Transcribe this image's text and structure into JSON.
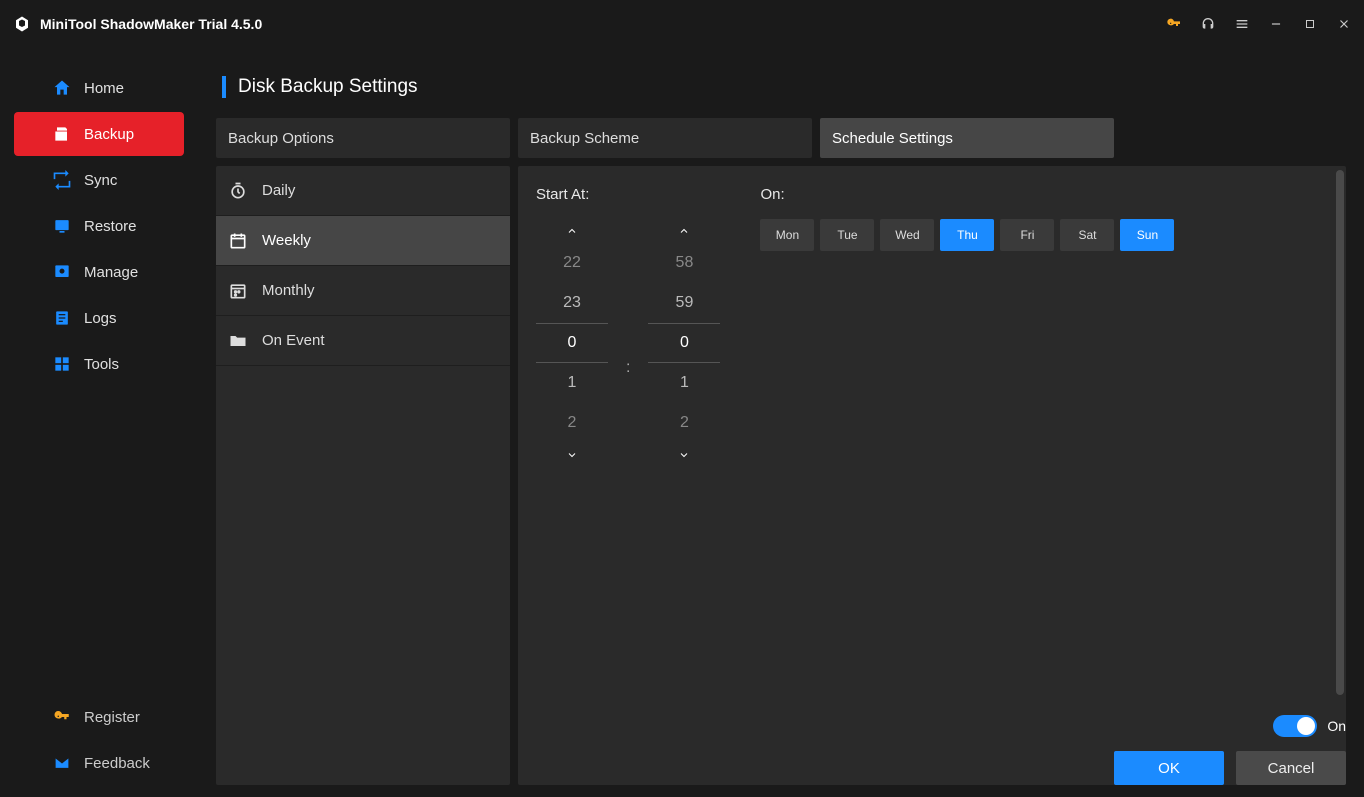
{
  "app": {
    "title": "MiniTool ShadowMaker Trial 4.5.0"
  },
  "sidebar": {
    "items": [
      {
        "label": "Home"
      },
      {
        "label": "Backup"
      },
      {
        "label": "Sync"
      },
      {
        "label": "Restore"
      },
      {
        "label": "Manage"
      },
      {
        "label": "Logs"
      },
      {
        "label": "Tools"
      }
    ],
    "bottom": [
      {
        "label": "Register"
      },
      {
        "label": "Feedback"
      }
    ]
  },
  "page": {
    "title": "Disk Backup Settings"
  },
  "tabs": [
    {
      "label": "Backup Options"
    },
    {
      "label": "Backup Scheme"
    },
    {
      "label": "Schedule Settings"
    }
  ],
  "frequency": [
    {
      "label": "Daily"
    },
    {
      "label": "Weekly"
    },
    {
      "label": "Monthly"
    },
    {
      "label": "On Event"
    }
  ],
  "schedule": {
    "start_label": "Start At:",
    "on_label": "On:",
    "hour": {
      "m2": "22",
      "m1": "23",
      "sel": "0",
      "p1": "1",
      "p2": "2"
    },
    "minute": {
      "m2": "58",
      "m1": "59",
      "sel": "0",
      "p1": "1",
      "p2": "2"
    },
    "colon": ":",
    "days": [
      {
        "label": "Mon",
        "active": false
      },
      {
        "label": "Tue",
        "active": false
      },
      {
        "label": "Wed",
        "active": false
      },
      {
        "label": "Thu",
        "active": true
      },
      {
        "label": "Fri",
        "active": false
      },
      {
        "label": "Sat",
        "active": false
      },
      {
        "label": "Sun",
        "active": true
      }
    ]
  },
  "footer": {
    "toggle_label": "On",
    "ok": "OK",
    "cancel": "Cancel"
  }
}
